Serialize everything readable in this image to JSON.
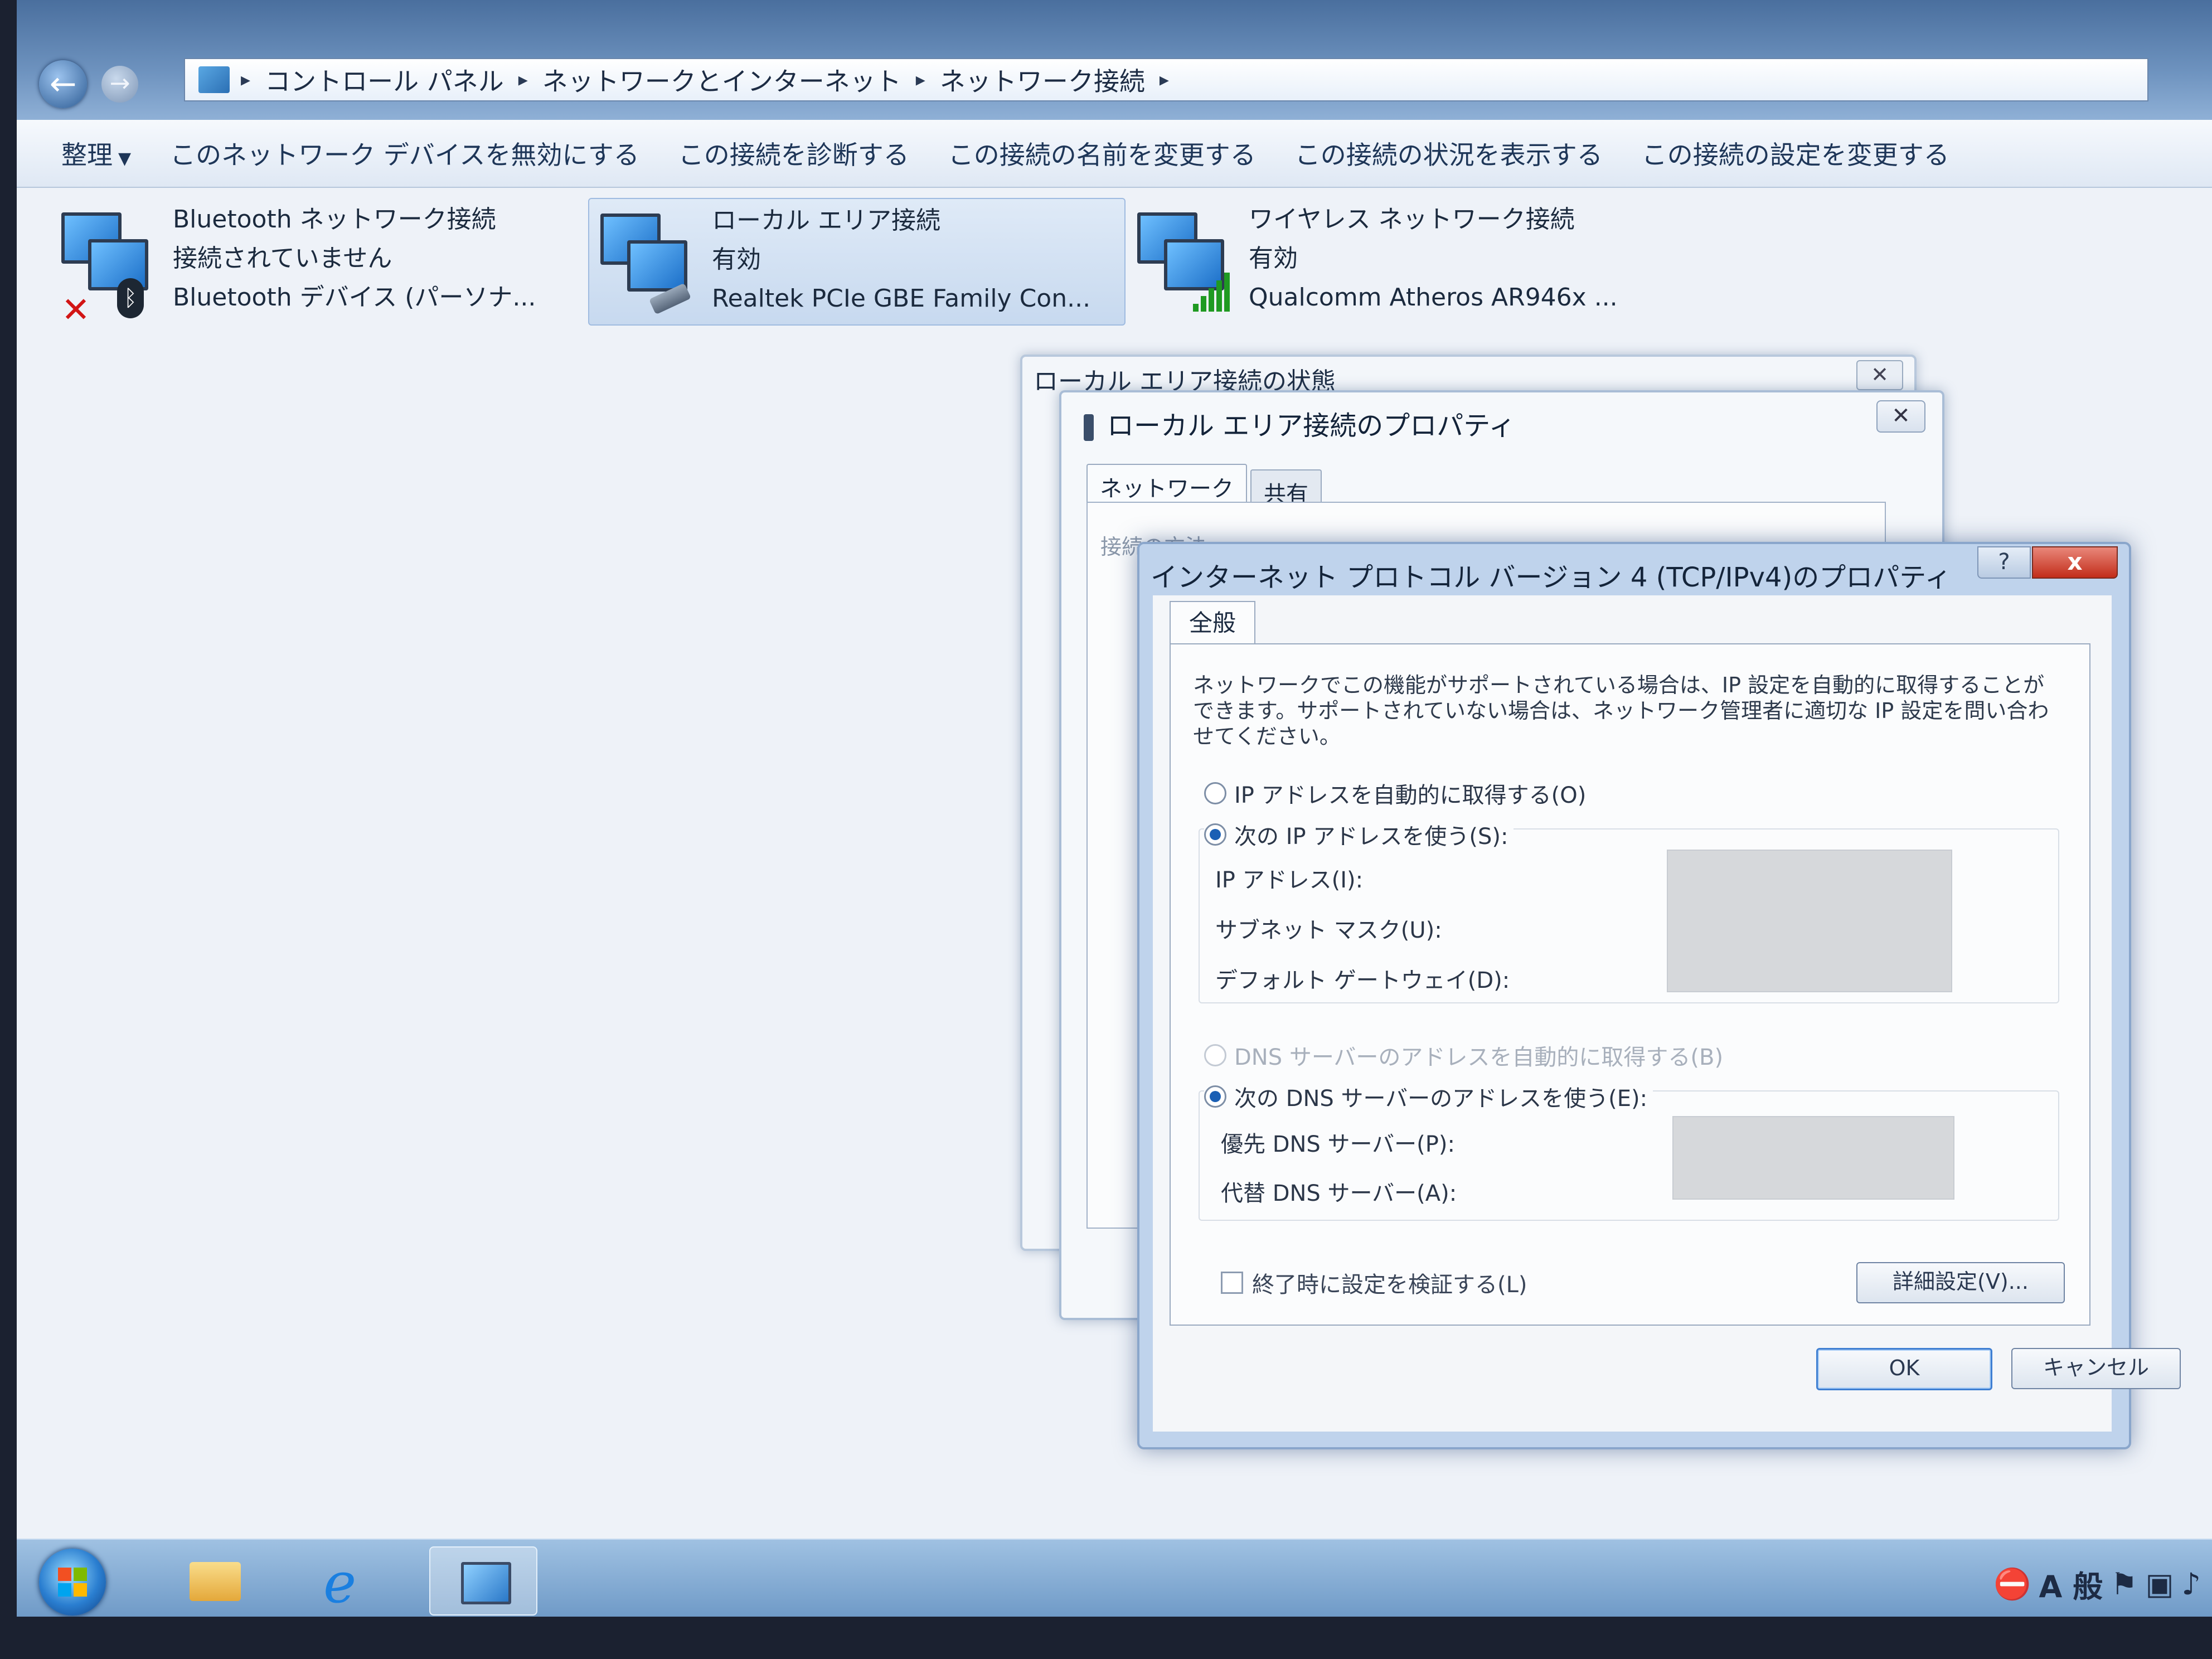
{
  "window": {
    "breadcrumb": [
      "コントロール パネル",
      "ネットワークとインターネット",
      "ネットワーク接続"
    ],
    "toolbar": {
      "organize": "整理",
      "disable": "このネットワーク デバイスを無効にする",
      "diagnose": "この接続を診断する",
      "rename": "この接続の名前を変更する",
      "status": "この接続の状況を表示する",
      "settings": "この接続の設定を変更する"
    }
  },
  "connections": [
    {
      "name": "Bluetooth ネットワーク接続",
      "status": "接続されていません",
      "device": "Bluetooth デバイス (パーソナ..."
    },
    {
      "name": "ローカル エリア接続",
      "status": "有効",
      "device": "Realtek PCIe GBE Family Con..."
    },
    {
      "name": "ワイヤレス ネットワーク接続",
      "status": "有効",
      "device": "Qualcomm Atheros AR946x ..."
    }
  ],
  "status_dialog": {
    "title": "ローカル エリア接続の状態"
  },
  "properties_dialog": {
    "title": "ローカル エリア接続のプロパティ",
    "tab_network": "ネットワーク",
    "tab_sharing": "共有",
    "partial_text": "接続の方法"
  },
  "ipv4_dialog": {
    "title": "インターネット プロトコル バージョン 4 (TCP/IPv4)のプロパティ",
    "help": "?",
    "close": "x",
    "tab_general": "全般",
    "description": "ネットワークでこの機能がサポートされている場合は、IP 設定を自動的に取得することができます。サポートされていない場合は、ネットワーク管理者に適切な IP 設定を問い合わせてください。",
    "ip_auto": "IP アドレスを自動的に取得する(O)",
    "ip_manual": "次の IP アドレスを使う(S):",
    "ip_address_label": "IP アドレス(I):",
    "subnet_label": "サブネット マスク(U):",
    "gateway_label": "デフォルト ゲートウェイ(D):",
    "dns_auto": "DNS サーバーのアドレスを自動的に取得する(B)",
    "dns_manual": "次の DNS サーバーのアドレスを使う(E):",
    "preferred_dns_label": "優先 DNS サーバー(P):",
    "alternate_dns_label": "代替 DNS サーバー(A):",
    "validate_label": "終了時に設定を検証する(L)",
    "advanced": "詳細設定(V)...",
    "ok": "OK",
    "cancel": "キャンセル"
  },
  "taskbar": {
    "ime_label": "A 般"
  }
}
